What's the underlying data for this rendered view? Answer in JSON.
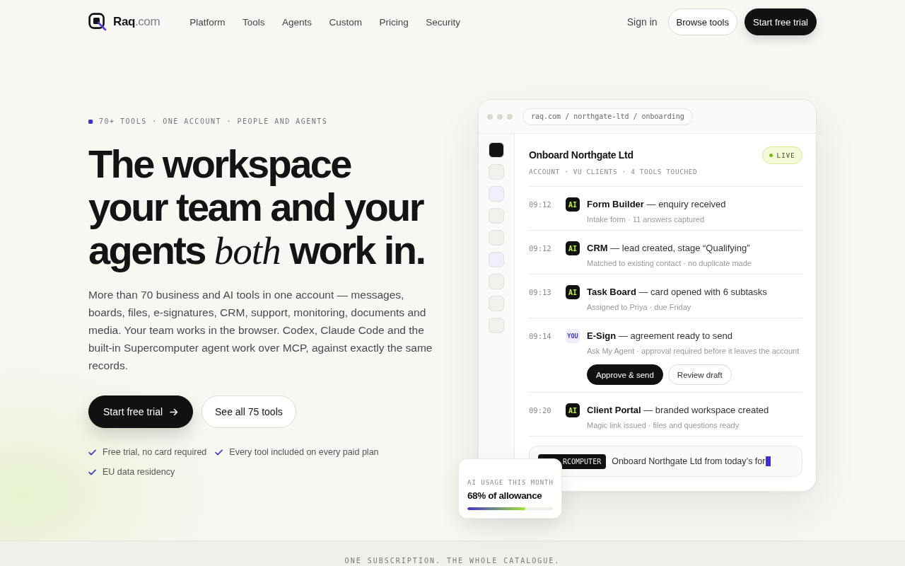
{
  "nav": {
    "brand": "Raq",
    "brand_suffix": ".com",
    "links": [
      "Platform",
      "Tools",
      "Agents",
      "Custom",
      "Pricing",
      "Security"
    ],
    "sign_in": "Sign in",
    "buttons": [
      {
        "label": "Browse tools",
        "kind": "secondary"
      },
      {
        "label": "Start free trial",
        "kind": "primary"
      }
    ]
  },
  "hero": {
    "eyebrow": "70+ TOOLS · ONE ACCOUNT · PEOPLE AND AGENTS",
    "heading": "The workspace your team and your agents *both* work in.",
    "body": "More than 70 business and AI tools in one account — messages, boards, files, e-signatures, CRM, support, monitoring, documents and media. Your team works in the browser. Codex, Claude Code and the built-in Supercomputer agent work over MCP, against exactly the same records.",
    "buttons": [
      {
        "label": "Start free trial",
        "kind": "primary"
      },
      {
        "label": "See all 75 tools",
        "kind": "secondary"
      }
    ],
    "checks": [
      "Free trial, no card required",
      "Every tool included on every paid plan",
      "EU data residency"
    ]
  },
  "app_window": {
    "address": "raq.com / northgate-ltd / onboarding",
    "sidebar": [
      {
        "color": "#141414"
      },
      {
        "color": "#f1f0ec"
      },
      {
        "color": "#efeefc"
      },
      {
        "color": "#f1f0ec"
      },
      {
        "color": "#f1f0ec"
      },
      {
        "color": "#efeefc"
      },
      {
        "color": "#f1f0ec"
      },
      {
        "color": "#f1f0ec"
      },
      {
        "color": "#f1f0ec"
      }
    ],
    "title": "Onboard Northgate Ltd",
    "status": "LIVE",
    "meta": "ACCOUNT · VU CLIENTS · 4 TOOLS TOUCHED",
    "activity": [
      {
        "time": "09:12",
        "actor": {
          "label": "AI",
          "kind": "agent"
        },
        "title": "**Form Builder** — enquiry received",
        "detail": "Intake form · 11 answers captured"
      },
      {
        "time": "09:12",
        "actor": {
          "label": "AI",
          "kind": "agent"
        },
        "title": "**CRM** — lead created, stage “Qualifying”",
        "detail": "Matched to existing contact · no duplicate made"
      },
      {
        "time": "09:13",
        "actor": {
          "label": "AI",
          "kind": "agent"
        },
        "title": "**Task Board** — card opened with 6 subtasks",
        "detail": "Assigned to Priya · due Friday"
      },
      {
        "time": "09:14",
        "actor": {
          "label": "YOU",
          "kind": "person"
        },
        "title": "**E-Sign** — agreement ready to send",
        "detail": "Ask My Agent · approval required before it leaves the account",
        "actions": [
          {
            "label": "Approve & send",
            "kind": "primary"
          },
          {
            "label": "Review draft",
            "kind": "secondary"
          }
        ]
      },
      {
        "time": "09:20",
        "actor": {
          "label": "AI",
          "kind": "agent"
        },
        "title": "**Client Portal** — branded workspace created",
        "detail": "Magic link issued · files and questions ready"
      }
    ],
    "command": {
      "chip": "RCOMPUTER",
      "text": "Onboard Northgate Ltd from today’s for"
    }
  },
  "usage": {
    "label": "AI USAGE THIS MONTH",
    "value": "68% of allowance",
    "level": 0.68
  },
  "footer_strip": "ONE SUBSCRIPTION. THE WHOLE CATALOGUE."
}
